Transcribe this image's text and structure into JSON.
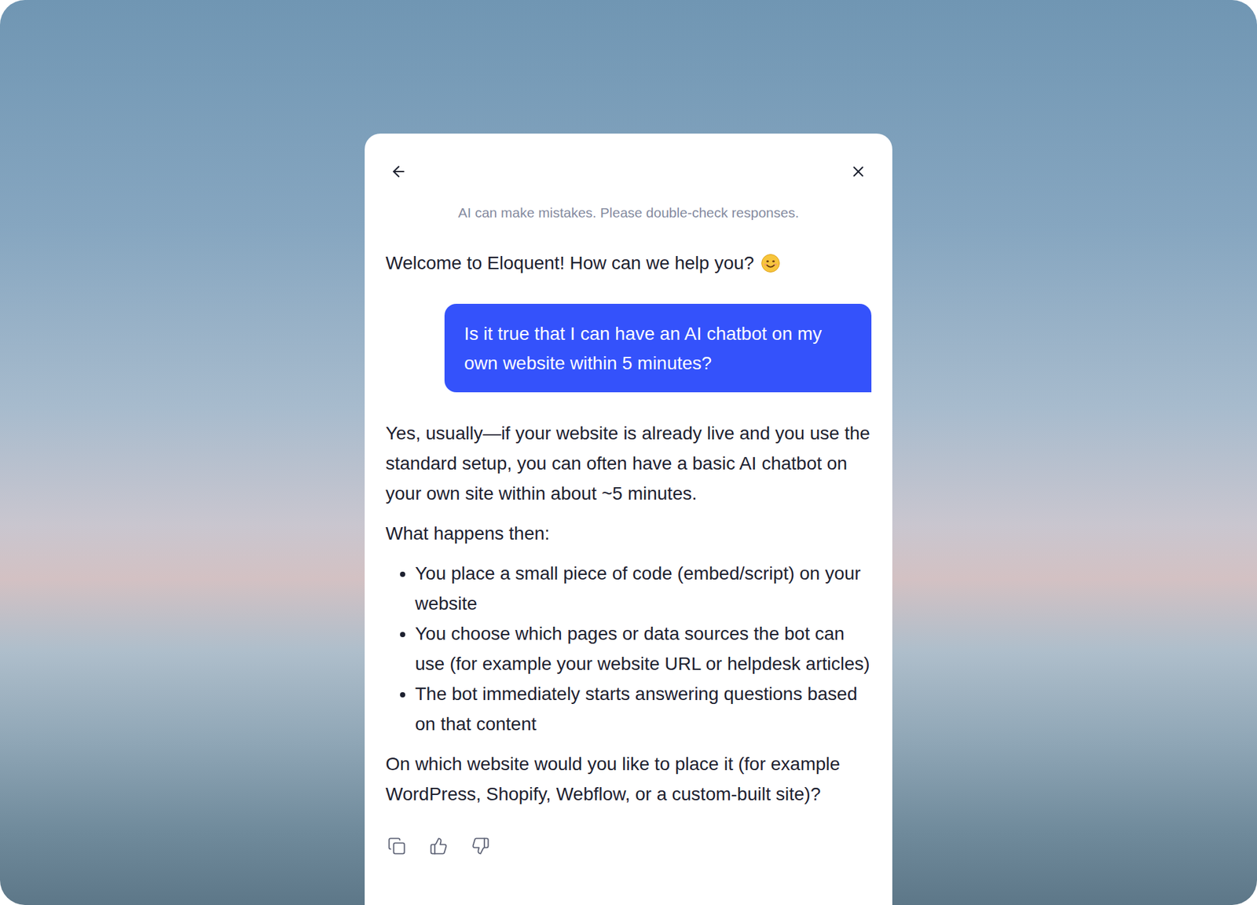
{
  "header": {
    "disclaimer": "AI can make mistakes. Please double-check responses."
  },
  "messages": [
    {
      "kind": "greeting",
      "text": "Welcome to Eloquent! How can we help you?"
    },
    {
      "kind": "user",
      "text": "Is it true that I can have an AI chatbot on my own website within 5 minutes?"
    },
    {
      "kind": "answer",
      "intro": "Yes, usually—if your website is already live and you use the standard setup, you can often have a basic AI chatbot on your own site within about ~5 minutes.",
      "subheading": "What happens then:",
      "bullets": [
        "You place a small piece of code (embed/script) on your website",
        "You choose which pages or data sources the bot can use (for example your website URL or helpdesk articles)",
        "The bot immediately starts answering questions based on that content"
      ],
      "question": "On which website would you like to place it (for example WordPress, Shopify, Webflow, or a custom-built site)?"
    }
  ]
}
